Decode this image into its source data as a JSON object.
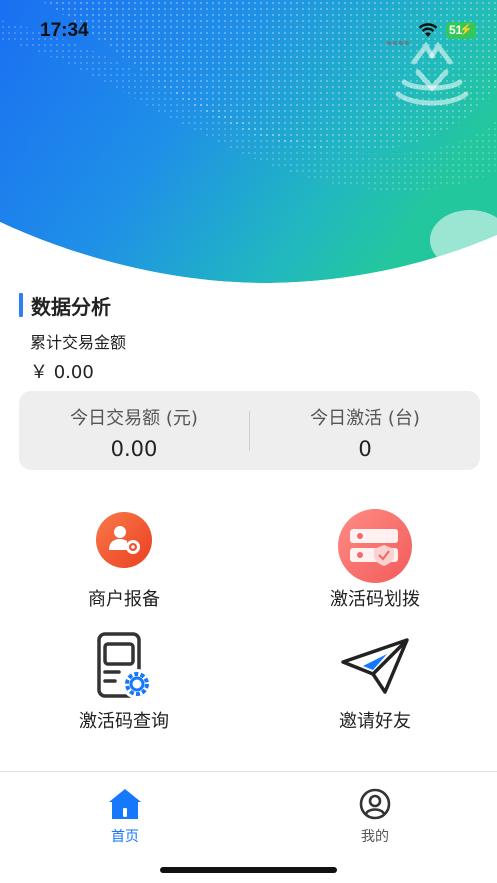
{
  "status_bar": {
    "time": "17:34",
    "battery": "51"
  },
  "colors": {
    "accent": "#1677ff",
    "hero_blue": "#1a6ff2",
    "hero_teal": "#22c3a0",
    "orange": "#f0572e",
    "pink": "#f26b6b",
    "card_bg": "#eeeeee"
  },
  "hero": {
    "logo_icon": "cup-logo-icon"
  },
  "data_section": {
    "title": "数据分析",
    "total_label": "累计交易金额",
    "total_value": "￥ 0.00",
    "today_amount_label": "今日交易额 (元)",
    "today_amount_value": "0.00",
    "today_activation_label": "今日激活 (台)",
    "today_activation_value": "0"
  },
  "features": [
    {
      "label": "商户报备",
      "icon": "merchant-settings-icon"
    },
    {
      "label": "激活码划拨",
      "icon": "server-shield-icon"
    },
    {
      "label": "激活码查询",
      "icon": "device-gear-icon"
    },
    {
      "label": "邀请好友",
      "icon": "paper-plane-icon"
    }
  ],
  "tabs": [
    {
      "label": "首页",
      "icon": "home-icon",
      "active": true
    },
    {
      "label": "我的",
      "icon": "user-icon",
      "active": false
    }
  ]
}
